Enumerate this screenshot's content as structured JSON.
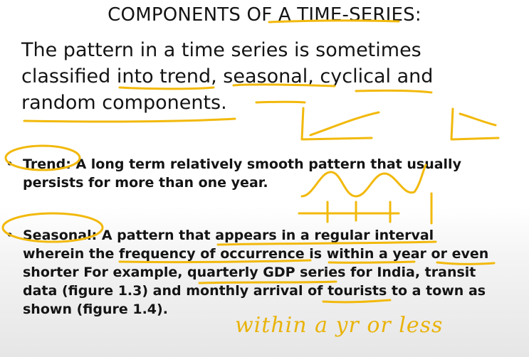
{
  "slide": {
    "title": "COMPONENTS OF A TIME-SERIES:",
    "intro_lines": [
      "The pattern in a time series is sometimes",
      "classified into trend, seasonal, cyclical and",
      "random components."
    ],
    "bullets": [
      {
        "marker": "•",
        "lines": [
          "Trend: A long term relatively smooth pattern that usually",
          "persists for more than one year."
        ]
      },
      {
        "marker": "•",
        "lines": [
          "Seasonal: A pattern that appears in a regular interval",
          "wherein the frequency of occurrence is within a year or even",
          "shorter For example, quarterly GDP series for India, transit",
          "data (figure 1.3) and monthly arrival of tourists to a town as",
          "shown (figure 1.4)."
        ]
      }
    ]
  },
  "annotations": {
    "handwritten_note": "within a yr or less",
    "ink_color": "#f2b90c"
  }
}
